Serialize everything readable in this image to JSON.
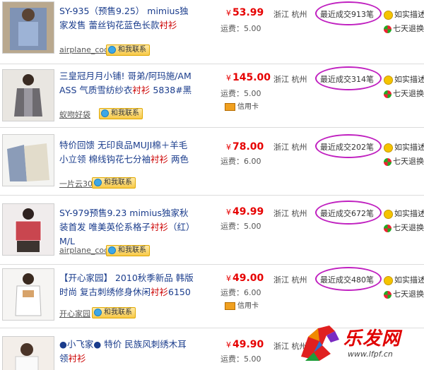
{
  "contact_label": "和我联系",
  "card_label": "信用卡",
  "desc_label": "如实描述",
  "return_label": "七天退换",
  "watermark": {
    "name": "乐发网",
    "url": "www.lfpf.cn"
  },
  "colors": {
    "price": "#e60000",
    "title": "#1a3c8c",
    "highlight": "#cc0000",
    "oval": "#c020c0"
  },
  "listings": [
    {
      "title_main": "SY-935（预售9.25） mimius独家发售 蕾丝钩花蓝色长款",
      "title_hl": "衬衫",
      "seller": "airplane_cood",
      "price": "53.99",
      "shipping": "运费：5.00",
      "location": "浙江 杭州",
      "sales": "最近成交913笔",
      "card": false
    },
    {
      "title_main": "三皇冠月月小铺! 哥弟/阿玛施/AMASS 气质雪纺纱衣",
      "title_hl": "衬衫",
      "title_tail": " 5838#黑",
      "seller": "蚁吻好袋",
      "price": "145.00",
      "shipping": "运费：5.00",
      "location": "浙江 杭州",
      "sales": "最近成交314笔",
      "card": true
    },
    {
      "title_main": "特价回馈 无印良品MUJI棉＋羊毛小立领 棉线钩花七分袖",
      "title_hl": "衬衫",
      "title_tail": " 两色",
      "seller": "一片云300",
      "price": "78.00",
      "shipping": "运费：6.00",
      "location": "浙江 杭州",
      "sales": "最近成交202笔",
      "card": false
    },
    {
      "title_main": "SY-979预售9.23 mimius独家秋装首发 唯美英伦系格子",
      "title_hl": "衬衫",
      "title_tail": "（红）M/L",
      "seller": "airplane_cood",
      "price": "49.99",
      "shipping": "运费：5.00",
      "location": "浙江 杭州",
      "sales": "最近成交672笔",
      "card": false
    },
    {
      "title_main": "【开心家园】 2010秋季新品 韩版时尚 复古刺绣修身休闲",
      "title_hl": "衬衫",
      "title_tail": "6150",
      "seller": "开心家园",
      "price": "49.00",
      "shipping": "运费：6.00",
      "location": "浙江 杭州",
      "sales": "最近成交480笔",
      "card": true
    },
    {
      "title_main": "●小飞家● 特价 民族风刺绣木耳领",
      "title_hl": "衬衫",
      "price": "49.90",
      "shipping": "运费：5.00",
      "location": "浙江 杭州"
    }
  ]
}
